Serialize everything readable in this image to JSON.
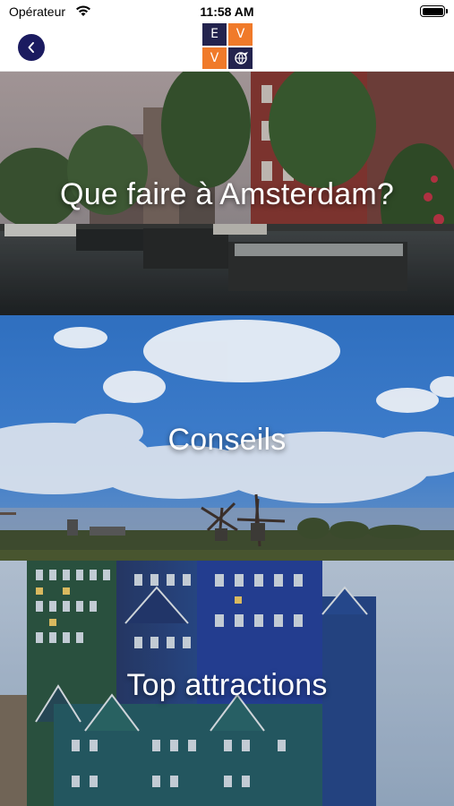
{
  "status_bar": {
    "carrier": "Opérateur",
    "time": "11:58 AM"
  },
  "nav": {
    "logo_letters": [
      "E",
      "V",
      "V"
    ],
    "back_icon": "chevron-left-icon",
    "colors": {
      "navy": "#23234e",
      "orange": "#f07a2a",
      "back": "#1b1b60"
    }
  },
  "tiles": [
    {
      "label": "Que faire à Amsterdam?"
    },
    {
      "label": "Conseils"
    },
    {
      "label": "Top attractions"
    }
  ]
}
